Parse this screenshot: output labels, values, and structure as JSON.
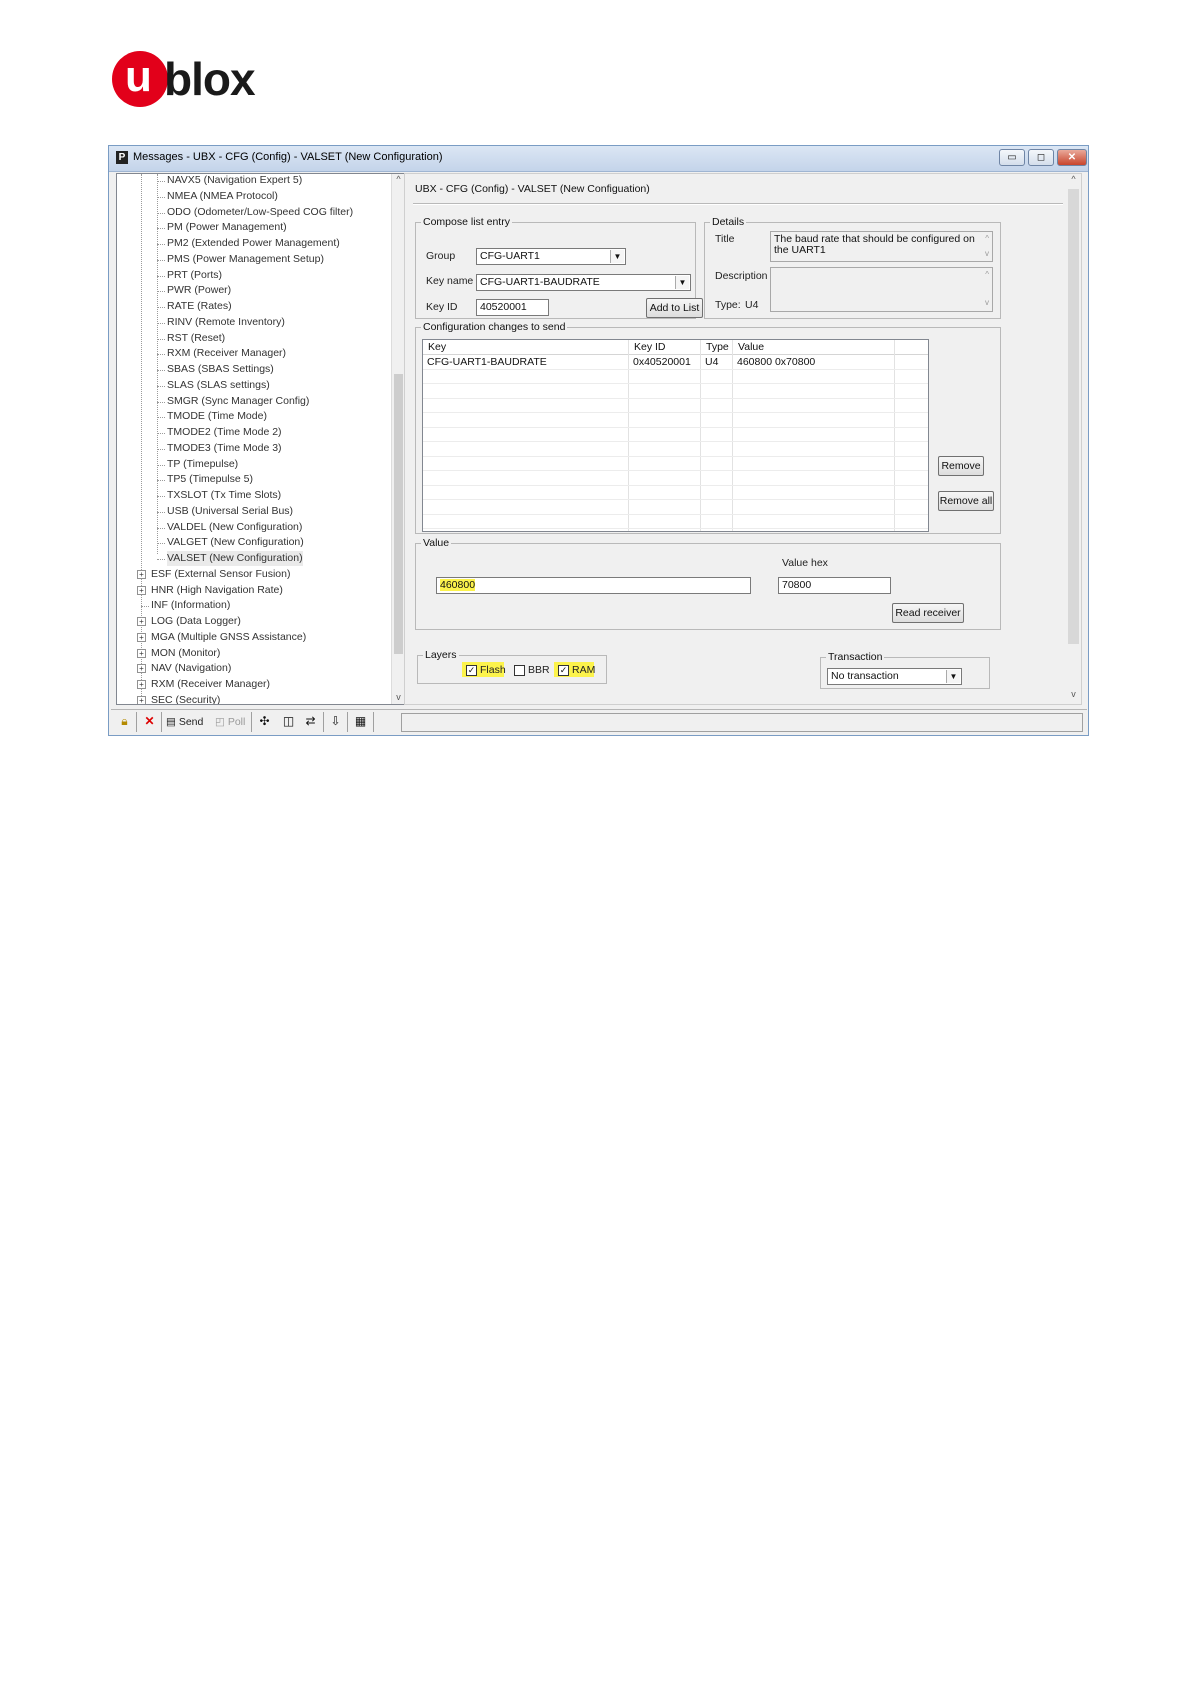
{
  "logo": {
    "letter": "u",
    "rest": "blox"
  },
  "window": {
    "title": "Messages - UBX - CFG (Config) - VALSET (New Configuration)",
    "controls": {
      "minimize": "▭",
      "maximize": "◻",
      "close": "✕"
    }
  },
  "tree": {
    "children": [
      "NAVX5 (Navigation Expert 5)",
      "NMEA (NMEA Protocol)",
      "ODO (Odometer/Low-Speed COG filter)",
      "PM (Power Management)",
      "PM2 (Extended Power Management)",
      "PMS (Power Management Setup)",
      "PRT (Ports)",
      "PWR (Power)",
      "RATE (Rates)",
      "RINV (Remote Inventory)",
      "RST (Reset)",
      "RXM (Receiver Manager)",
      "SBAS (SBAS Settings)",
      "SLAS (SLAS settings)",
      "SMGR (Sync Manager Config)",
      "TMODE (Time Mode)",
      "TMODE2 (Time Mode 2)",
      "TMODE3 (Time Mode 3)",
      "TP (Timepulse)",
      "TP5 (Timepulse 5)",
      "TXSLOT (Tx Time Slots)",
      "USB (Universal Serial Bus)",
      "VALDEL (New Configuration)",
      "VALGET (New Configuration)",
      "VALSET (New Configuration)"
    ],
    "groups": [
      {
        "label": "ESF (External Sensor Fusion)",
        "expandable": true
      },
      {
        "label": "HNR (High Navigation Rate)",
        "expandable": true
      },
      {
        "label": "INF (Information)",
        "expandable": false
      },
      {
        "label": "LOG (Data Logger)",
        "expandable": true
      },
      {
        "label": "MGA (Multiple GNSS Assistance)",
        "expandable": true
      },
      {
        "label": "MON (Monitor)",
        "expandable": true
      },
      {
        "label": "NAV (Navigation)",
        "expandable": true
      },
      {
        "label": "RXM (Receiver Manager)",
        "expandable": true
      },
      {
        "label": "SEC (Security)",
        "expandable": true
      }
    ],
    "expander_symbol": "+"
  },
  "toolbar": {
    "send_label": "Send",
    "poll_label": "Poll"
  },
  "panel": {
    "heading": "UBX - CFG (Config) - VALSET (New Configuation)",
    "compose": {
      "legend": "Compose list entry",
      "group_label": "Group",
      "group_value": "CFG-UART1",
      "keyname_label": "Key name",
      "keyname_value": "CFG-UART1-BAUDRATE",
      "keyid_label": "Key ID",
      "keyid_value": "40520001",
      "add_button": "Add to List"
    },
    "details": {
      "legend": "Details",
      "title_label": "Title",
      "title_value": "The baud rate that should be configured on the UART1",
      "description_label": "Description",
      "description_value": "",
      "type_label": "Type:",
      "type_value": "U4"
    },
    "changes": {
      "legend": "Configuration changes to send",
      "columns": [
        "Key",
        "Key ID",
        "Type",
        "Value"
      ],
      "rows": [
        {
          "key": "CFG-UART1-BAUDRATE",
          "key_id": "0x40520001",
          "type": "U4",
          "value": "460800  0x70800"
        }
      ],
      "remove_button": "Remove",
      "remove_all_button": "Remove all"
    },
    "value": {
      "legend": "Value",
      "value": "460800",
      "hex_label": "Value hex",
      "hex_value": "70800",
      "read_button": "Read receiver"
    },
    "layers": {
      "legend": "Layers",
      "flash": {
        "label": "Flash",
        "checked": true
      },
      "bbr": {
        "label": "BBR",
        "checked": false
      },
      "ram": {
        "label": "RAM",
        "checked": true
      }
    },
    "transaction": {
      "legend": "Transaction",
      "value": "No transaction"
    }
  },
  "symbols": {
    "check": "✓",
    "drop": "▼",
    "up": "^",
    "down": "v"
  },
  "colors": {
    "highlight": "#fcf34c",
    "brand_red": "#e2001a"
  }
}
